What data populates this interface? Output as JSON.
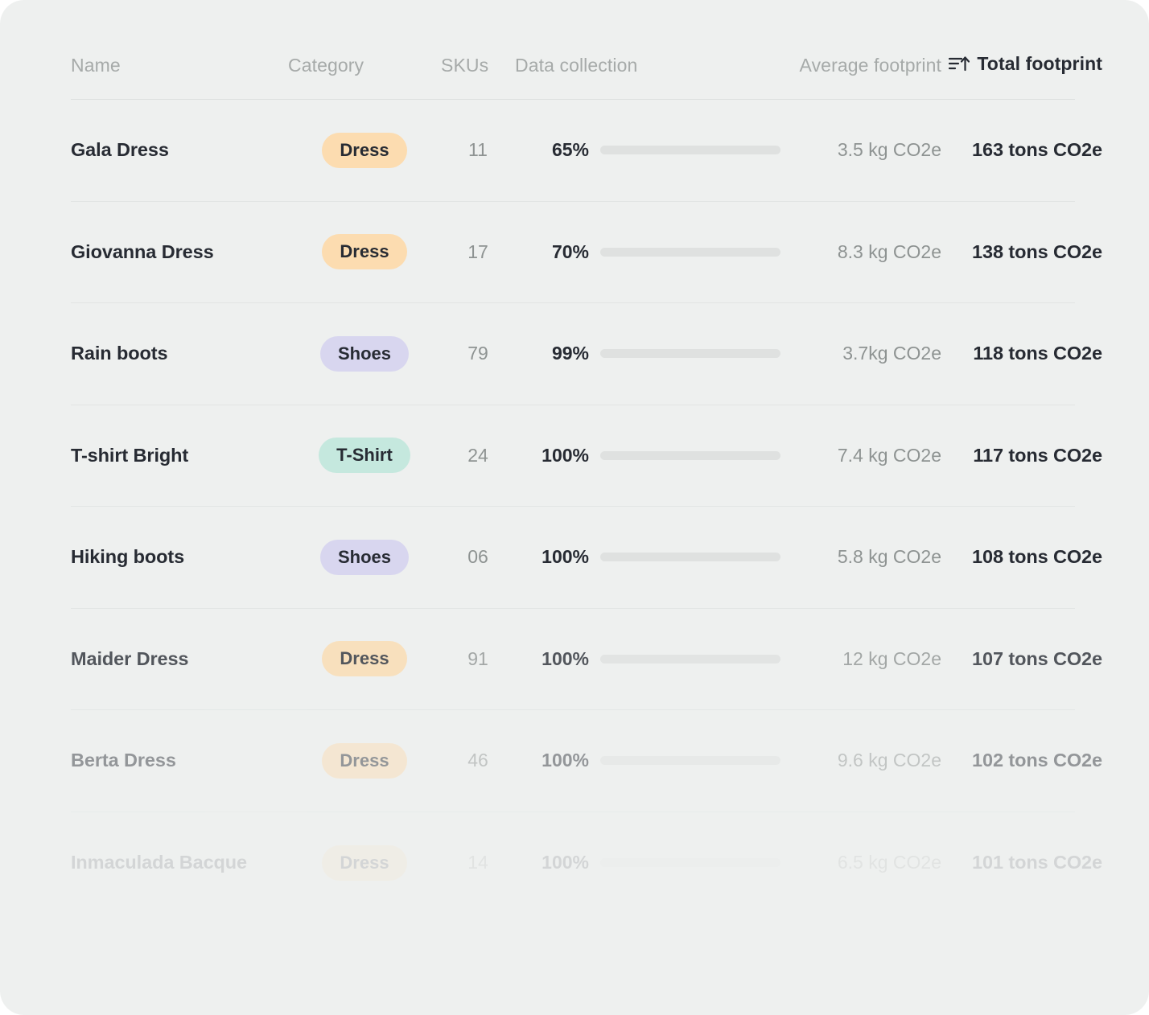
{
  "theme": {
    "page_background": "#eef0ef",
    "divider": "#e2e5e4",
    "text_primary": "#272b33",
    "text_muted": "#8e9392",
    "header_muted": "#a6aaa9",
    "bar_track": "#dfe1e0",
    "bar_fill": "#8e9392",
    "badge_dress": "#fcdcb0",
    "badge_shoes": "#d8d6ef",
    "badge_tshirt": "#c5e8de"
  },
  "table": {
    "sort": {
      "column": "Total footprint",
      "icon": "sort-ascending-icon",
      "direction": "ascending"
    },
    "columns": [
      {
        "key": "name",
        "label": "Name"
      },
      {
        "key": "category",
        "label": "Category"
      },
      {
        "key": "skus",
        "label": "SKUs"
      },
      {
        "key": "data",
        "label": "Data collection"
      },
      {
        "key": "avg",
        "label": "Average footprint"
      },
      {
        "key": "total",
        "label": "Total footprint"
      }
    ],
    "rows": [
      {
        "name": "Gala Dress",
        "category": "Dress",
        "category_color": "#fcdcb0",
        "skus": "11",
        "data_collection_label": "65%",
        "data_collection_value": 65,
        "average_footprint": "3.5 kg CO2e",
        "total_footprint": "163 tons CO2e",
        "opacity": 1
      },
      {
        "name": "Giovanna Dress",
        "category": "Dress",
        "category_color": "#fcdcb0",
        "skus": "17",
        "data_collection_label": "70%",
        "data_collection_value": 70,
        "average_footprint": "8.3 kg CO2e",
        "total_footprint": "138 tons CO2e",
        "opacity": 1
      },
      {
        "name": "Rain boots",
        "category": "Shoes",
        "category_color": "#d8d6ef",
        "skus": "79",
        "data_collection_label": "99%",
        "data_collection_value": 99,
        "average_footprint": "3.7kg CO2e",
        "total_footprint": "118 tons CO2e",
        "opacity": 1
      },
      {
        "name": "T-shirt Bright",
        "category": "T-Shirt",
        "category_color": "#c5e8de",
        "skus": "24",
        "data_collection_label": "100%",
        "data_collection_value": 100,
        "average_footprint": "7.4 kg CO2e",
        "total_footprint": "117 tons CO2e",
        "opacity": 1
      },
      {
        "name": "Hiking boots",
        "category": "Shoes",
        "category_color": "#d8d6ef",
        "skus": "06",
        "data_collection_label": "100%",
        "data_collection_value": 100,
        "average_footprint": "5.8 kg CO2e",
        "total_footprint": "108 tons CO2e",
        "opacity": 1
      },
      {
        "name": "Maider Dress",
        "category": "Dress",
        "category_color": "#fcdcb0",
        "skus": "91",
        "data_collection_label": "100%",
        "data_collection_value": 100,
        "average_footprint": "12 kg CO2e",
        "total_footprint": "107 tons CO2e",
        "opacity": 0.78
      },
      {
        "name": "Berta Dress",
        "category": "Dress",
        "category_color": "#fcdcb0",
        "skus": "46",
        "data_collection_label": "100%",
        "data_collection_value": 100,
        "average_footprint": "9.6 kg CO2e",
        "total_footprint": "102 tons CO2e",
        "opacity": 0.45
      },
      {
        "name": "Inmaculada Bacque",
        "category": "Dress",
        "category_color": "#fcdcb0",
        "skus": "14",
        "data_collection_label": "100%",
        "data_collection_value": 100,
        "average_footprint": "6.5 kg CO2e",
        "total_footprint": "101 tons CO2e",
        "opacity": 0.13
      }
    ]
  }
}
